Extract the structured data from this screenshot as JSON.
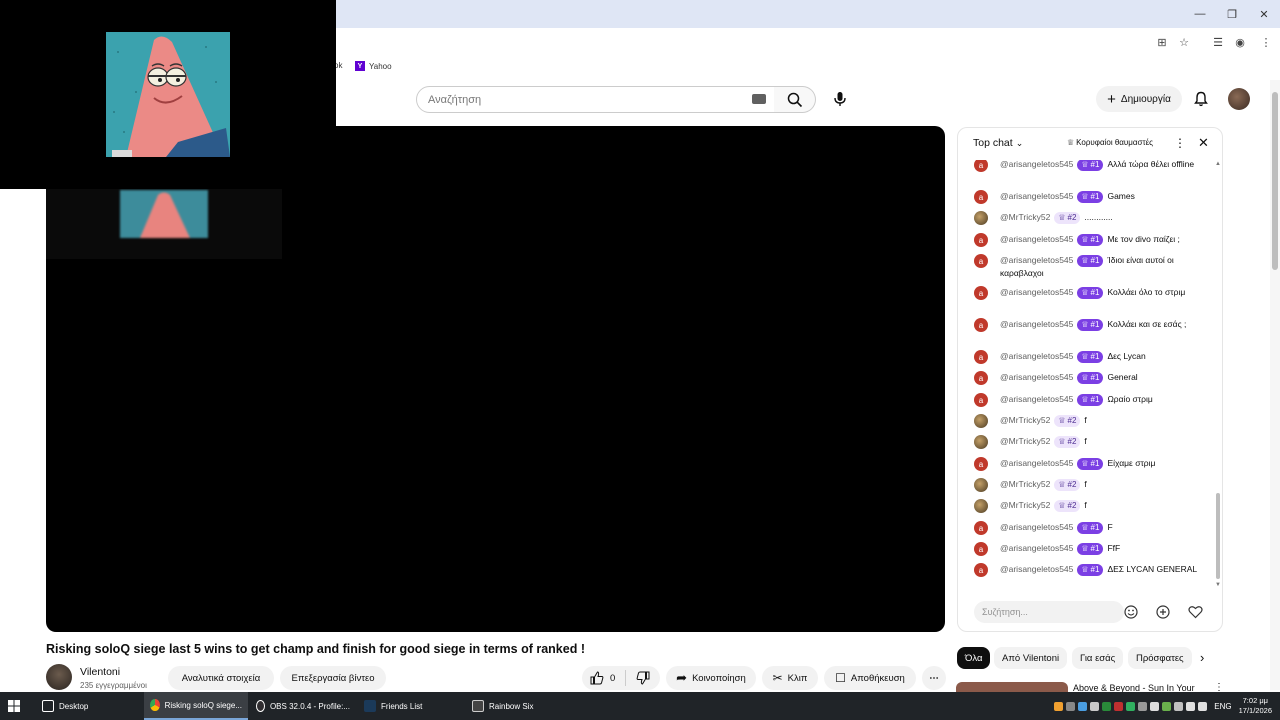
{
  "browser": {
    "bookmarks": [
      {
        "label": "ok"
      },
      {
        "label": "Yahoo",
        "icon_letter": "Y"
      }
    ]
  },
  "header": {
    "search_placeholder": "Αναζήτηση",
    "create_label": "Δημιουργία"
  },
  "video": {
    "title": "Risking soloQ siege last 5 wins to get champ and finish for good siege in terms of ranked !",
    "channel": "Vilentoni",
    "subscribers": "235 εγγεγραμμένοι",
    "analytics_label": "Αναλυτικά στοιχεία",
    "edit_label": "Επεξεργασία βίντεο",
    "likes": "0",
    "share_label": "Κοινοποίηση",
    "clip_label": "Κλιπ",
    "save_label": "Αποθήκευση"
  },
  "chat": {
    "mode": "Top chat",
    "top_fans": "Κορυφαίοι θαυμαστές",
    "input_placeholder": "Συζήτηση...",
    "messages": [
      {
        "user": "@arisangeletos545",
        "badge": "#1",
        "text": "Αλλά τώρα θέλει offline"
      },
      {
        "user": "@arisangeletos545",
        "badge": "#1",
        "text": "Games"
      },
      {
        "user": "@MrTricky52",
        "badge": "#2",
        "text": "............"
      },
      {
        "user": "@arisangeletos545",
        "badge": "#1",
        "text": "Με τον divo παίζει ;"
      },
      {
        "user": "@arisangeletos545",
        "badge": "#1",
        "text": "Ίδιοι είναι αυτοί οι καραβλαχοι"
      },
      {
        "user": "@arisangeletos545",
        "badge": "#1",
        "text": "Κολλάει όλο το στριμ"
      },
      {
        "user": "@arisangeletos545",
        "badge": "#1",
        "text": "Κολλάει και σε εσάς ;"
      },
      {
        "user": "@arisangeletos545",
        "badge": "#1",
        "text": "Δες Lycan"
      },
      {
        "user": "@arisangeletos545",
        "badge": "#1",
        "text": "General"
      },
      {
        "user": "@arisangeletos545",
        "badge": "#1",
        "text": "Ωραίο στριμ"
      },
      {
        "user": "@MrTricky52",
        "badge": "#2",
        "text": "f"
      },
      {
        "user": "@MrTricky52",
        "badge": "#2",
        "text": "f"
      },
      {
        "user": "@arisangeletos545",
        "badge": "#1",
        "text": "Είχαμε στριμ"
      },
      {
        "user": "@MrTricky52",
        "badge": "#2",
        "text": "f"
      },
      {
        "user": "@MrTricky52",
        "badge": "#2",
        "text": "f"
      },
      {
        "user": "@arisangeletos545",
        "badge": "#1",
        "text": "F"
      },
      {
        "user": "@arisangeletos545",
        "badge": "#1",
        "text": "FfF"
      },
      {
        "user": "@arisangeletos545",
        "badge": "#1",
        "text": "ΔΕΣ LYCAN GENERAL"
      }
    ]
  },
  "chips": [
    "Όλα",
    "Από Vilentoni",
    "Για εσάς",
    "Πρόσφατες"
  ],
  "recommendation": {
    "title": "Above & Beyond - Sun In Your"
  },
  "taskbar": {
    "items": [
      "Desktop",
      "Risking soloQ siege...",
      "OBS 32.0.4 - Profile:...",
      "Friends List",
      "Rainbow Six"
    ],
    "lang": "ENG",
    "time": "7:02 μμ",
    "date": "17/1/2026"
  }
}
